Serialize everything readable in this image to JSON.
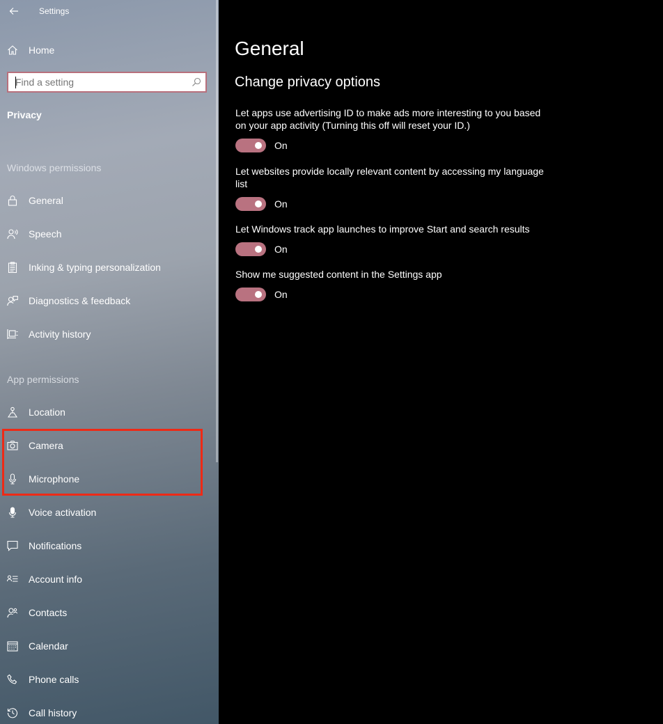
{
  "window": {
    "title": "Settings"
  },
  "sidebar": {
    "home_label": "Home",
    "search_placeholder": "Find a setting",
    "section_title": "Privacy",
    "groups": [
      {
        "header": "Windows permissions",
        "items": [
          {
            "label": "General",
            "icon": "lock-icon"
          },
          {
            "label": "Speech",
            "icon": "speech-icon"
          },
          {
            "label": "Inking & typing personalization",
            "icon": "clipboard-icon"
          },
          {
            "label": "Diagnostics & feedback",
            "icon": "feedback-icon"
          },
          {
            "label": "Activity history",
            "icon": "timeline-icon"
          }
        ]
      },
      {
        "header": "App permissions",
        "items": [
          {
            "label": "Location",
            "icon": "location-icon"
          },
          {
            "label": "Camera",
            "icon": "camera-icon"
          },
          {
            "label": "Microphone",
            "icon": "microphone-icon"
          },
          {
            "label": "Voice activation",
            "icon": "voice-activation-icon"
          },
          {
            "label": "Notifications",
            "icon": "notifications-icon"
          },
          {
            "label": "Account info",
            "icon": "account-info-icon"
          },
          {
            "label": "Contacts",
            "icon": "contacts-icon"
          },
          {
            "label": "Calendar",
            "icon": "calendar-icon"
          },
          {
            "label": "Phone calls",
            "icon": "phone-icon"
          },
          {
            "label": "Call history",
            "icon": "history-icon"
          }
        ]
      }
    ]
  },
  "main": {
    "title": "General",
    "subtitle": "Change privacy options",
    "settings": [
      {
        "description": "Let apps use advertising ID to make ads more interesting to you based on your app activity (Turning this off will reset your ID.)",
        "state": "On"
      },
      {
        "description": "Let websites provide locally relevant content by accessing my language list",
        "state": "On"
      },
      {
        "description": "Let Windows track app launches to improve Start and search results",
        "state": "On"
      },
      {
        "description": "Show me suggested content in the Settings app",
        "state": "On"
      }
    ]
  },
  "colors": {
    "toggle_on": "#b97280",
    "search_border": "#b8707c",
    "highlight_annotation": "#ee2a16"
  }
}
